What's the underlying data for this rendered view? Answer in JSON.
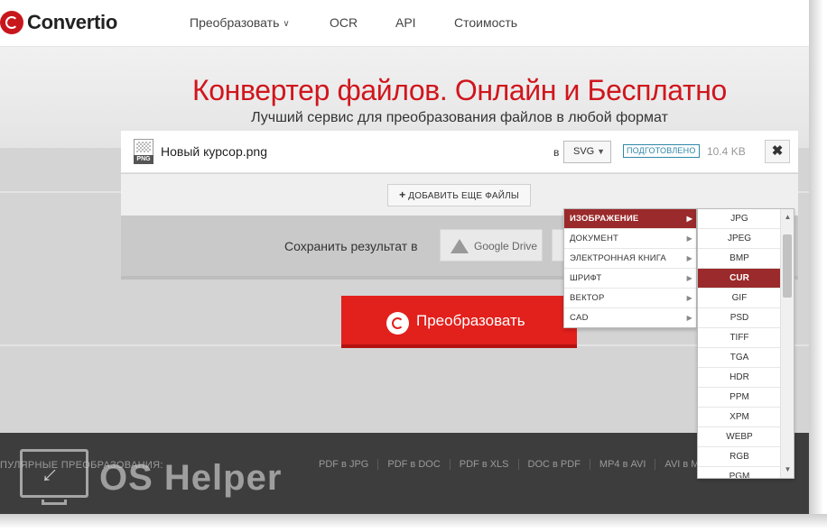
{
  "brand": {
    "name": "Convertio"
  },
  "nav": {
    "items": [
      {
        "label": "Преобразовать",
        "has_dropdown": true
      },
      {
        "label": "OCR"
      },
      {
        "label": "API"
      },
      {
        "label": "Стоимость"
      }
    ]
  },
  "hero": {
    "title": "Конвертер файлов. Онлайн и Бесплатно",
    "subtitle": "Лучший сервис для преобразования файлов в любой формат"
  },
  "file": {
    "name": "Новый курсор.png",
    "icon_tag": "PNG",
    "to_label": "в",
    "target_format": "SVG",
    "status": "ПОДГОТОВЛЕНО",
    "size": "10.4 KB",
    "remove_icon": "✖"
  },
  "add_files": {
    "label": "ДОБАВИТЬ ЕЩЕ ФАЙЛЫ"
  },
  "save": {
    "label": "Сохранить результат в",
    "google_drive": "Google Drive"
  },
  "convert": {
    "label": "Преобразовать"
  },
  "category_menu": {
    "items": [
      {
        "label": "ИЗОБРАЖЕНИЕ",
        "active": true
      },
      {
        "label": "ДОКУМЕНТ"
      },
      {
        "label": "ЭЛЕКТРОННАЯ КНИГА"
      },
      {
        "label": "ШРИФТ"
      },
      {
        "label": "ВЕКТОР"
      },
      {
        "label": "CAD"
      }
    ]
  },
  "format_menu": {
    "items": [
      "JPG",
      "JPEG",
      "BMP",
      "CUR",
      "GIF",
      "PSD",
      "TIFF",
      "TGA",
      "HDR",
      "PPM",
      "XPM",
      "WEBP",
      "RGB",
      "PGM"
    ],
    "active": "CUR"
  },
  "footer": {
    "title": "ПУЛЯРНЫЕ ПРЕОБРАЗОВАНИЯ:",
    "links": [
      "PDF в JPG",
      "PDF в DOC",
      "PDF в XLS",
      "DOC в PDF",
      "MP4 в AVI",
      "AVI в M"
    ]
  },
  "watermark": {
    "text": "OS Helper"
  },
  "colors": {
    "brand_red": "#d0161d",
    "button_red": "#e2201c",
    "menu_active": "#9a2a2b",
    "badge_blue": "#2f87a8"
  }
}
